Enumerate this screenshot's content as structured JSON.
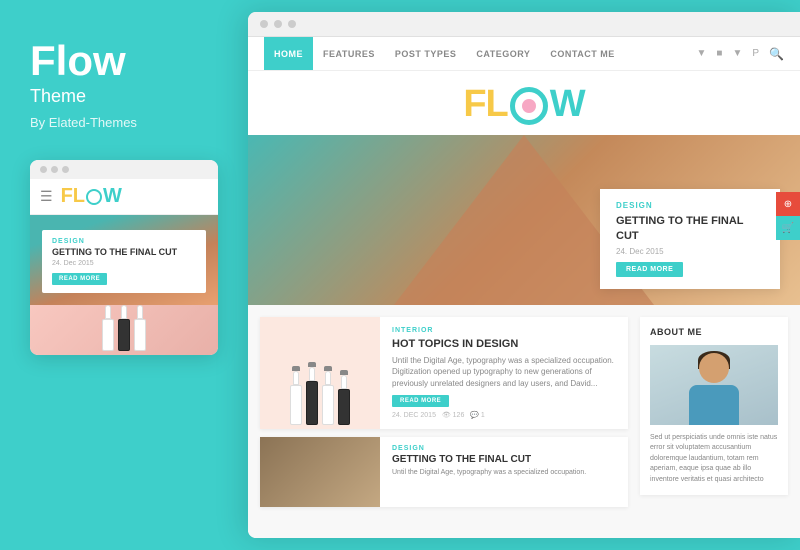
{
  "brand": {
    "title": "Flow",
    "subtitle": "Theme",
    "author": "By Elated-Themes"
  },
  "nav": {
    "items": [
      {
        "label": "HOME",
        "active": true
      },
      {
        "label": "FEATURES",
        "active": false
      },
      {
        "label": "POST TYPES",
        "active": false
      },
      {
        "label": "CATEGORY",
        "active": false
      },
      {
        "label": "CONTACT ME",
        "active": false
      }
    ],
    "icons": [
      "▼",
      "■",
      "▼",
      "P"
    ],
    "search_icon": "🔍"
  },
  "hero": {
    "category": "DESIGN",
    "title": "GETTING TO THE FINAL CUT",
    "date": "24. Dec 2015",
    "read_more": "READ MORE"
  },
  "post1": {
    "category": "INTERIOR",
    "title": "HOT TOPICS IN DESIGN",
    "description": "Until the Digital Age, typography was a specialized occupation. Digitization opened up typography to new generations of previously unrelated designers and lay users, and David...",
    "read_more": "READ MORE",
    "date": "24. DEC 2015",
    "views": "126",
    "comments": "1"
  },
  "post2": {
    "category": "DESIGN",
    "title": "GETTING TO THE FINAL CUT",
    "description": "Until the Digital Age, typography was a specialized occupation."
  },
  "sidebar": {
    "widget_title": "ABOUT ME",
    "description": "Sed ut perspiciatis unde omnis iste natus error sit voluptatem accusantium doloremque laudantium, totam rem aperiam, eaque ipsa quae ab illo inventore veritatis et quasi architecto"
  },
  "mobile": {
    "category": "DESIGN",
    "title": "GETTING TO THE FINAL CUT",
    "date": "24. Dec 2015",
    "read_more": "READ MORE"
  },
  "colors": {
    "teal": "#3ecfca",
    "yellow": "#f7c948",
    "pink": "#f7a8c4",
    "text_dark": "#333333",
    "text_light": "#888888"
  }
}
